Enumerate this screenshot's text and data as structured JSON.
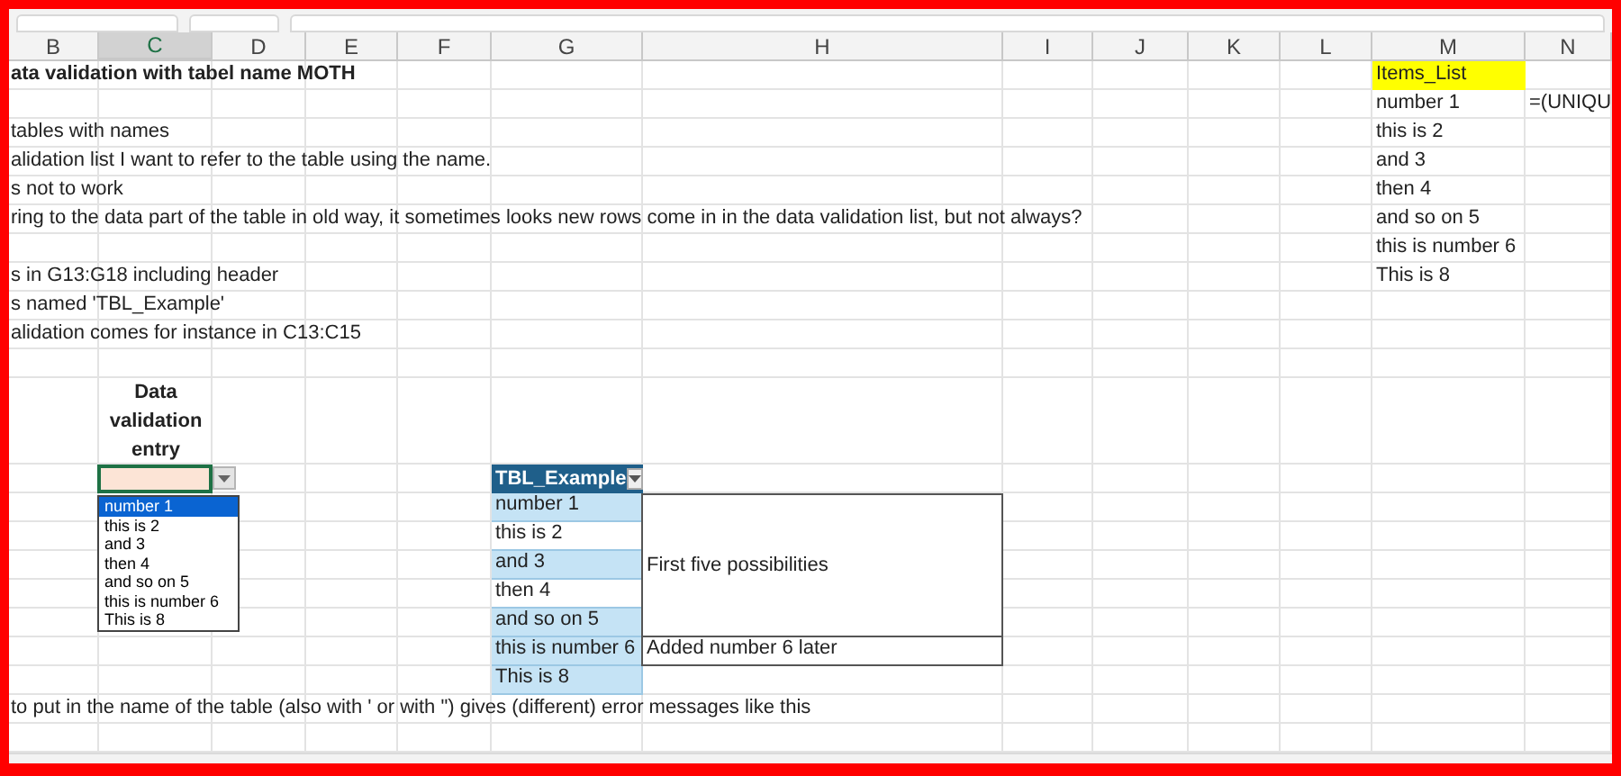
{
  "column_headers": [
    {
      "label": "B",
      "selected": false
    },
    {
      "label": "C",
      "selected": true
    },
    {
      "label": "D",
      "selected": false
    },
    {
      "label": "E",
      "selected": false
    },
    {
      "label": "F",
      "selected": false
    },
    {
      "label": "G",
      "selected": false
    },
    {
      "label": "H",
      "selected": false
    },
    {
      "label": "I",
      "selected": false
    },
    {
      "label": "J",
      "selected": false
    },
    {
      "label": "K",
      "selected": false
    },
    {
      "label": "L",
      "selected": false
    },
    {
      "label": "M",
      "selected": false
    },
    {
      "label": "N",
      "selected": false
    }
  ],
  "title": "ata validation with tabel name MOTH",
  "notes": [
    "tables with names",
    "alidation list I want to refer to the table using the name.",
    "s not to work",
    "ring to the data part of the table in old way, it sometimes looks new rows come in in the data validation list, but not always?",
    "s in G13:G18 including header",
    "s named 'TBL_Example'",
    "alidation comes for instance in C13:C15"
  ],
  "entry_label": "Data validation entry",
  "dropdown_list": [
    {
      "label": "number 1",
      "selected": true
    },
    {
      "label": "this is 2",
      "selected": false
    },
    {
      "label": "and 3",
      "selected": false
    },
    {
      "label": "then 4",
      "selected": false
    },
    {
      "label": "and so on 5",
      "selected": false
    },
    {
      "label": "this is number 6",
      "selected": false
    },
    {
      "label": "This is 8",
      "selected": false
    }
  ],
  "table": {
    "name": "TBL_Example",
    "rows": [
      {
        "value": "number 1",
        "banded": true
      },
      {
        "value": "this is 2",
        "banded": false
      },
      {
        "value": "and 3",
        "banded": true
      },
      {
        "value": "then 4",
        "banded": false
      },
      {
        "value": "and so on 5",
        "banded": true
      },
      {
        "value": "this is number 6",
        "banded": true
      },
      {
        "value": "This is 8",
        "banded": true
      }
    ]
  },
  "comments": [
    "First five possibilities",
    "Added number 6 later"
  ],
  "footer_note": "to put in the name of the table (also with ' or with \") gives (different) error messages like this",
  "items_list": {
    "header": "Items_List",
    "items": [
      "number 1",
      "this is 2",
      "and 3",
      "then 4",
      "and so on 5",
      "this is number 6",
      "This is 8"
    ]
  },
  "formula": "=(UNIQU"
}
